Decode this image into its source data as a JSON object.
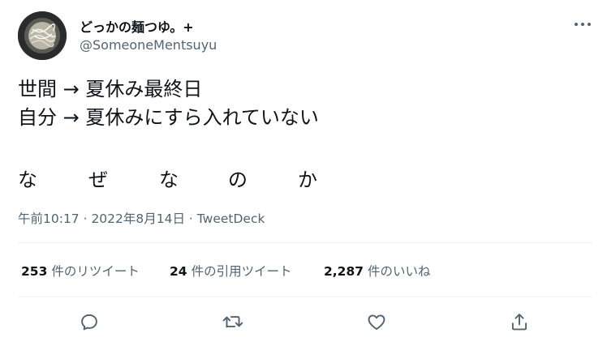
{
  "author": {
    "display_name": "どっかの麺つゆ。+",
    "handle": "@SomeoneMentsuyu"
  },
  "tweet": {
    "line1": "世間 → 夏休み最終日",
    "line2": "自分 → 夏休みにすら入れていない",
    "emphasis_chars": [
      "な",
      "ぜ",
      "な",
      "の",
      "か"
    ]
  },
  "meta": {
    "timestamp": "午前10:17 · 2022年8月14日 · ",
    "source": "TweetDeck"
  },
  "stats": {
    "retweets": {
      "count": "253",
      "label": "件のリツイート"
    },
    "quotes": {
      "count": "24",
      "label": "件の引用ツイート"
    },
    "likes": {
      "count": "2,287",
      "label": "件のいいね"
    }
  },
  "icons": {
    "more": "more-horizontal-icon",
    "reply": "reply-icon",
    "retweet": "retweet-icon",
    "like": "heart-icon",
    "share": "share-icon"
  },
  "colors": {
    "text": "#0f1419",
    "secondary": "#536471",
    "divider": "#eff3f4"
  }
}
